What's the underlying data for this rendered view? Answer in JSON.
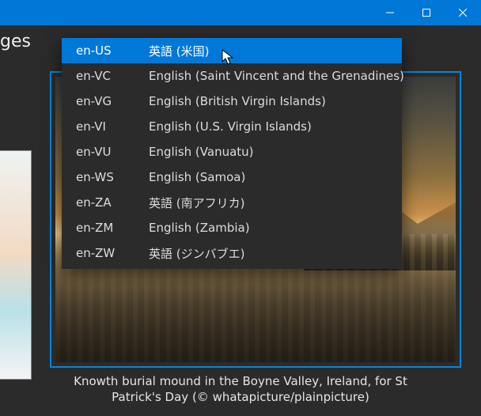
{
  "window": {
    "header_fragment": "ges"
  },
  "dropdown": {
    "items": [
      {
        "code": "en-US",
        "label": "英語 (米国)",
        "selected": true
      },
      {
        "code": "en-VC",
        "label": "English (Saint Vincent and the Grenadines)",
        "selected": false
      },
      {
        "code": "en-VG",
        "label": "English (British Virgin Islands)",
        "selected": false
      },
      {
        "code": "en-VI",
        "label": "English (U.S. Virgin Islands)",
        "selected": false
      },
      {
        "code": "en-VU",
        "label": "English (Vanuatu)",
        "selected": false
      },
      {
        "code": "en-WS",
        "label": "English (Samoa)",
        "selected": false
      },
      {
        "code": "en-ZA",
        "label": "英語 (南アフリカ)",
        "selected": false
      },
      {
        "code": "en-ZM",
        "label": "English (Zambia)",
        "selected": false
      },
      {
        "code": "en-ZW",
        "label": "英語 (ジンバブエ)",
        "selected": false
      }
    ]
  },
  "caption": {
    "line1": "Knowth burial mound in the Boyne Valley, Ireland, for St",
    "line2": "Patrick's Day (© whatapicture/plainpicture)"
  }
}
